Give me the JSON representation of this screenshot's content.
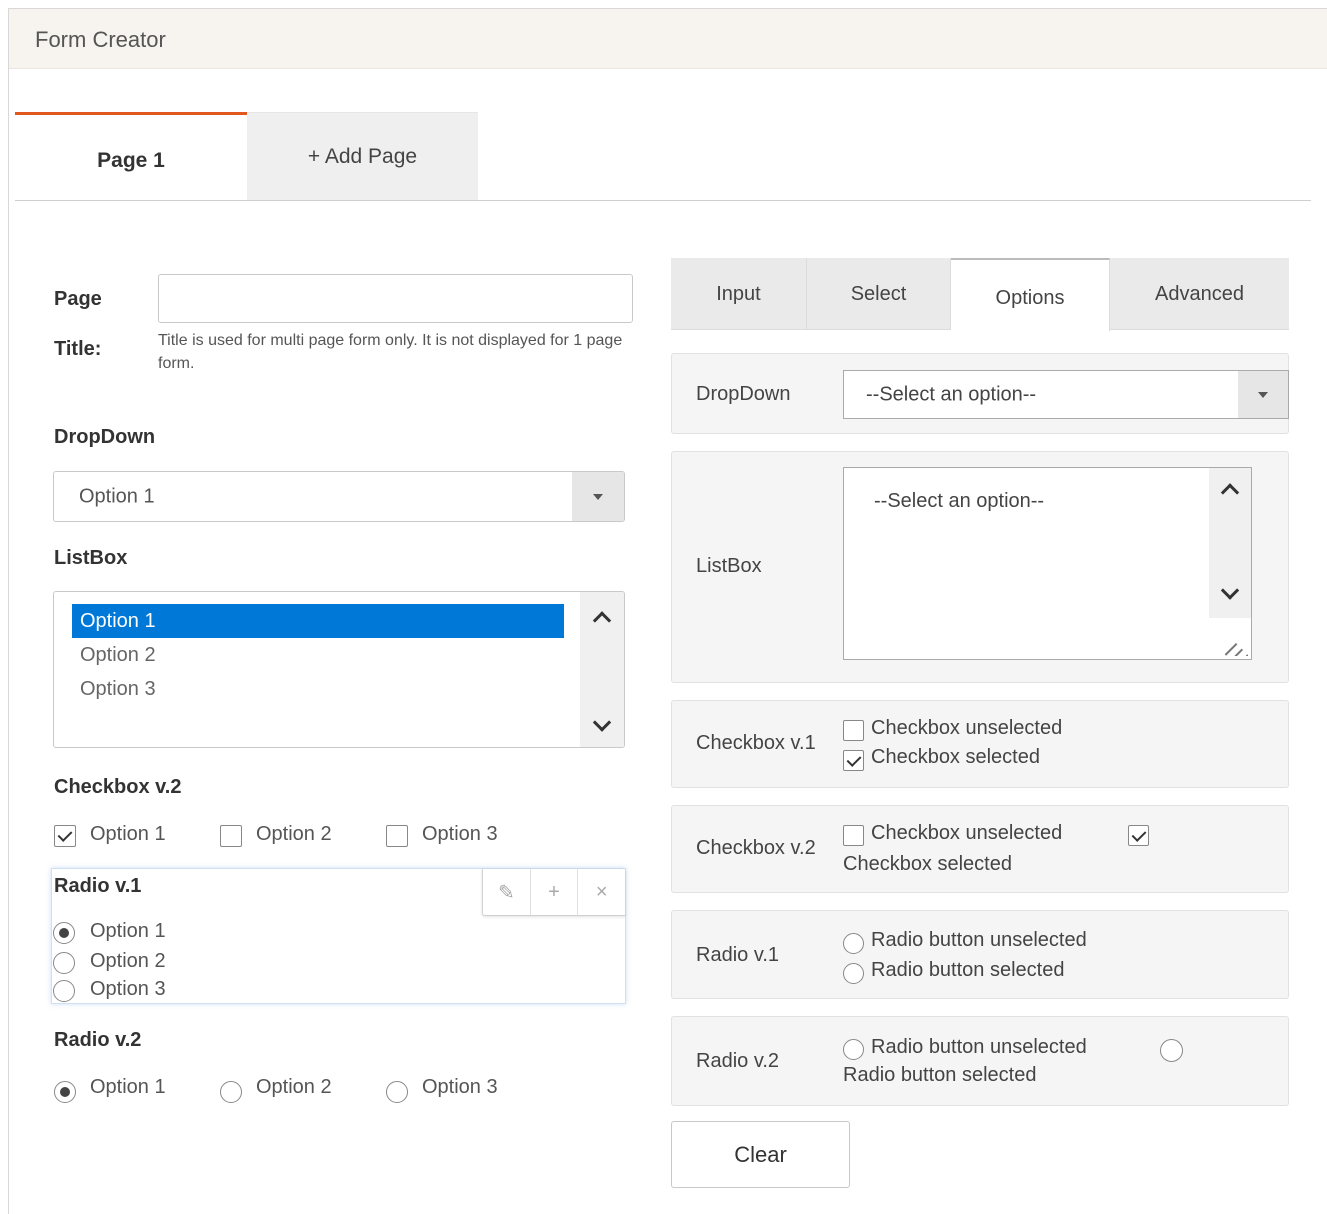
{
  "window": {
    "title": "Form Creator"
  },
  "page_tabs": {
    "active": "Page 1",
    "add": "+ Add Page"
  },
  "page_title": {
    "label_line1": "Page",
    "label_line2": "Title:",
    "value": "",
    "hint": "Title is used for multi page form only. It is not displayed for 1 page form."
  },
  "dropdown": {
    "label": "DropDown",
    "value": "Option 1"
  },
  "listbox": {
    "label": "ListBox",
    "options": [
      "Option 1",
      "Option 2",
      "Option 3"
    ],
    "selected": "Option 1"
  },
  "checkbox_v2": {
    "label": "Checkbox v.2",
    "options": [
      {
        "label": "Option 1",
        "checked": true
      },
      {
        "label": "Option 2",
        "checked": false
      },
      {
        "label": "Option 3",
        "checked": false
      }
    ]
  },
  "radio_v1": {
    "label": "Radio v.1",
    "selected": "Option 1",
    "options": [
      "Option 1",
      "Option 2",
      "Option 3"
    ],
    "tools": [
      "edit-icon",
      "plus-icon",
      "close-icon"
    ]
  },
  "radio_v2": {
    "label": "Radio v.2",
    "selected": "Option 1",
    "options": [
      "Option 1",
      "Option 2",
      "Option 3"
    ]
  },
  "property_tabs": {
    "tabs": [
      "Input",
      "Select",
      "Options",
      "Advanced"
    ],
    "active": "Options"
  },
  "props": {
    "dropdown": {
      "label": "DropDown",
      "value": "--Select an option--"
    },
    "listbox": {
      "label": "ListBox",
      "value": "--Select an option--"
    },
    "checkbox_v1": {
      "label": "Checkbox v.1",
      "unselected": "Checkbox unselected",
      "selected": "Checkbox selected"
    },
    "checkbox_v2": {
      "label": "Checkbox v.2",
      "unselected": "Checkbox unselected",
      "selected": "Checkbox selected"
    },
    "radio_v1": {
      "label": "Radio v.1",
      "unselected": "Radio button unselected",
      "selected": "Radio button selected"
    },
    "radio_v2": {
      "label": "Radio v.2",
      "unselected": "Radio button unselected",
      "selected": "Radio button selected"
    }
  },
  "clear_button": "Clear",
  "colors": {
    "accent": "#e2571e",
    "selection": "#0078d7",
    "titlebar": "#f7f3ee"
  }
}
